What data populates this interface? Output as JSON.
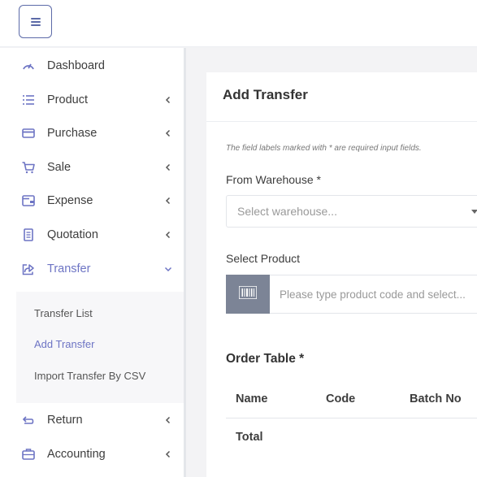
{
  "colors": {
    "accent": "#6d74c4",
    "toggle_border": "#5c6aa8",
    "barcode_bg": "#7c8496"
  },
  "header": {
    "menu_toggle_icon": "hamburger-icon"
  },
  "sidebar": {
    "items": [
      {
        "label": "Dashboard",
        "icon": "dashboard-gauge-icon",
        "chevron": ""
      },
      {
        "label": "Product",
        "icon": "list-icon",
        "chevron": "‹"
      },
      {
        "label": "Purchase",
        "icon": "card-icon",
        "chevron": "‹"
      },
      {
        "label": "Sale",
        "icon": "cart-icon",
        "chevron": "‹"
      },
      {
        "label": "Expense",
        "icon": "wallet-icon",
        "chevron": "‹"
      },
      {
        "label": "Quotation",
        "icon": "document-icon",
        "chevron": "‹"
      },
      {
        "label": "Transfer",
        "icon": "share-icon",
        "chevron": "⌄"
      },
      {
        "label": "Return",
        "icon": "return-arrow-icon",
        "chevron": "‹"
      },
      {
        "label": "Accounting",
        "icon": "briefcase-icon",
        "chevron": "‹"
      }
    ],
    "transfer_submenu": [
      {
        "label": "Transfer List"
      },
      {
        "label": "Add Transfer"
      },
      {
        "label": "Import Transfer By CSV"
      }
    ]
  },
  "main": {
    "title": "Add Transfer",
    "required_hint": "The field labels marked with * are required input fields.",
    "from_warehouse": {
      "label": "From Warehouse *",
      "placeholder": "Select warehouse..."
    },
    "select_product": {
      "label": "Select Product",
      "placeholder": "Please type product code and select...",
      "barcode_icon": "barcode-icon"
    },
    "order_table": {
      "title": "Order Table *",
      "columns": [
        "Name",
        "Code",
        "Batch No"
      ],
      "footer": "Total"
    }
  }
}
